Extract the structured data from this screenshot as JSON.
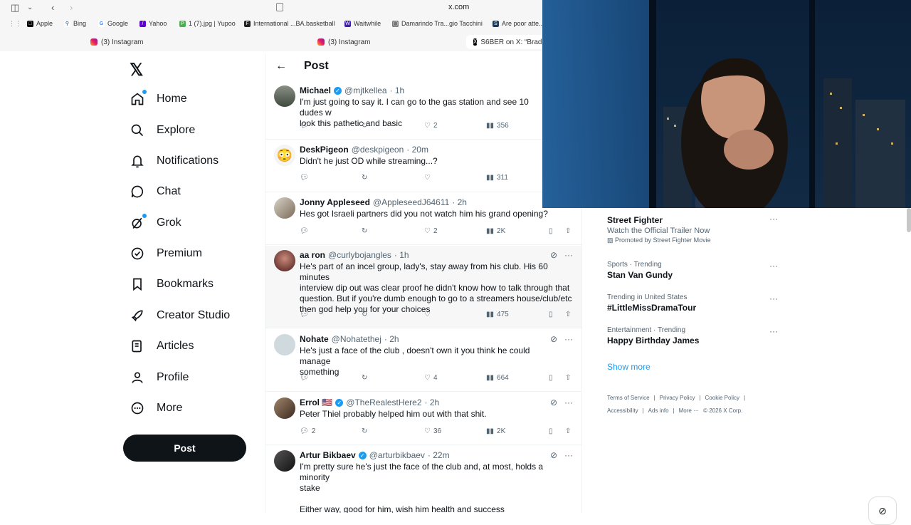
{
  "browser": {
    "url": "x.com",
    "bookmarks": [
      "Apple",
      "Bing",
      "Google",
      "Yahoo",
      "1 (7).jpg | Yupoo",
      "International ...BA.basketball",
      "Waitwhile",
      "Damarindo Tra...gio Tacchini",
      "Are poor atte..."
    ],
    "tabs": [
      "(3) Instagram",
      "(3) Instagram",
      "S6BER on X: “Brad"
    ]
  },
  "nav": {
    "logo": "𝕏",
    "items": [
      "Home",
      "Explore",
      "Notifications",
      "Chat",
      "Grok",
      "Premium",
      "Bookmarks",
      "Creator Studio",
      "Articles",
      "Profile",
      "More"
    ],
    "post_label": "Post"
  },
  "header": {
    "back": "←",
    "title": "Post"
  },
  "replies": [
    {
      "name": "Michael",
      "verified": true,
      "handle": "@mjtkellea",
      "time": "· 1h",
      "text": "I'm just going to say it. I can go to the gas station and see 10 dudes w\nlook this pathetic and basic",
      "replies": "",
      "likes": "2",
      "views": "356"
    },
    {
      "name": "DeskPigeon",
      "verified": false,
      "handle": "@deskpigeon",
      "time": "· 20m",
      "text": "Didn't he just OD while streaming...?",
      "replies": "",
      "likes": "",
      "views": "311"
    },
    {
      "name": "Jonny Appleseed",
      "verified": false,
      "handle": "@AppleseedJ64611",
      "time": "· 2h",
      "text": "Hes got Israeli partners did you not watch him his grand opening?",
      "replies": "",
      "likes": "2",
      "views": "2K"
    },
    {
      "name": "aa ron",
      "verified": false,
      "handle": "@curlybojangles",
      "time": "· 1h",
      "text": "He's part of an incel group, lady's, stay away from his club. His 60 minutes\ninterview dip out was clear proof he didn't know how to talk through that\nquestion. But if you're dumb enough to go to a streamers house/club/etc\nthen god help you for your choices",
      "replies": "",
      "likes": "",
      "views": "475"
    },
    {
      "name": "Nohate",
      "verified": false,
      "handle": "@Nohatethej",
      "time": "· 2h",
      "text": "He's just a face of the club , doesn't own it you think he could manage\nsomething",
      "replies": "",
      "likes": "4",
      "views": "664"
    },
    {
      "name": "Errol 🇺🇸",
      "verified": true,
      "handle": "@TheRealestHere2",
      "time": "· 2h",
      "text": "Peter Thiel probably helped him out with that shit.",
      "replies": "2",
      "likes": "36",
      "views": "2K"
    },
    {
      "name": "Artur Bikbaev",
      "verified": true,
      "handle": "@arturbikbaev",
      "time": "· 22m",
      "text": "I'm pretty sure he's just the face of the club and, at most, holds a minority\nstake\n\nEither way, good for him, wish him health and success",
      "replies": "",
      "likes": "",
      "views": ""
    }
  ],
  "sidebar": {
    "promo": {
      "name": "Street Fighter",
      "sub": "Watch the Official Trailer Now",
      "by": "Promoted by Street Fighter Movie"
    },
    "trends": [
      {
        "cat": "Sports · Trending",
        "name": "Stan Van Gundy"
      },
      {
        "cat": "Trending in United States",
        "name": "#LittleMissDramaTour"
      },
      {
        "cat": "Entertainment · Trending",
        "name": "Happy Birthday James"
      }
    ],
    "show_more": "Show more",
    "footer": [
      "Terms of Service",
      "|",
      "Privacy Policy",
      "|",
      "Cookie Policy",
      "|",
      "Accessibility",
      "|",
      "Ads info",
      "|",
      "More ···",
      "© 2026 X Corp."
    ]
  }
}
